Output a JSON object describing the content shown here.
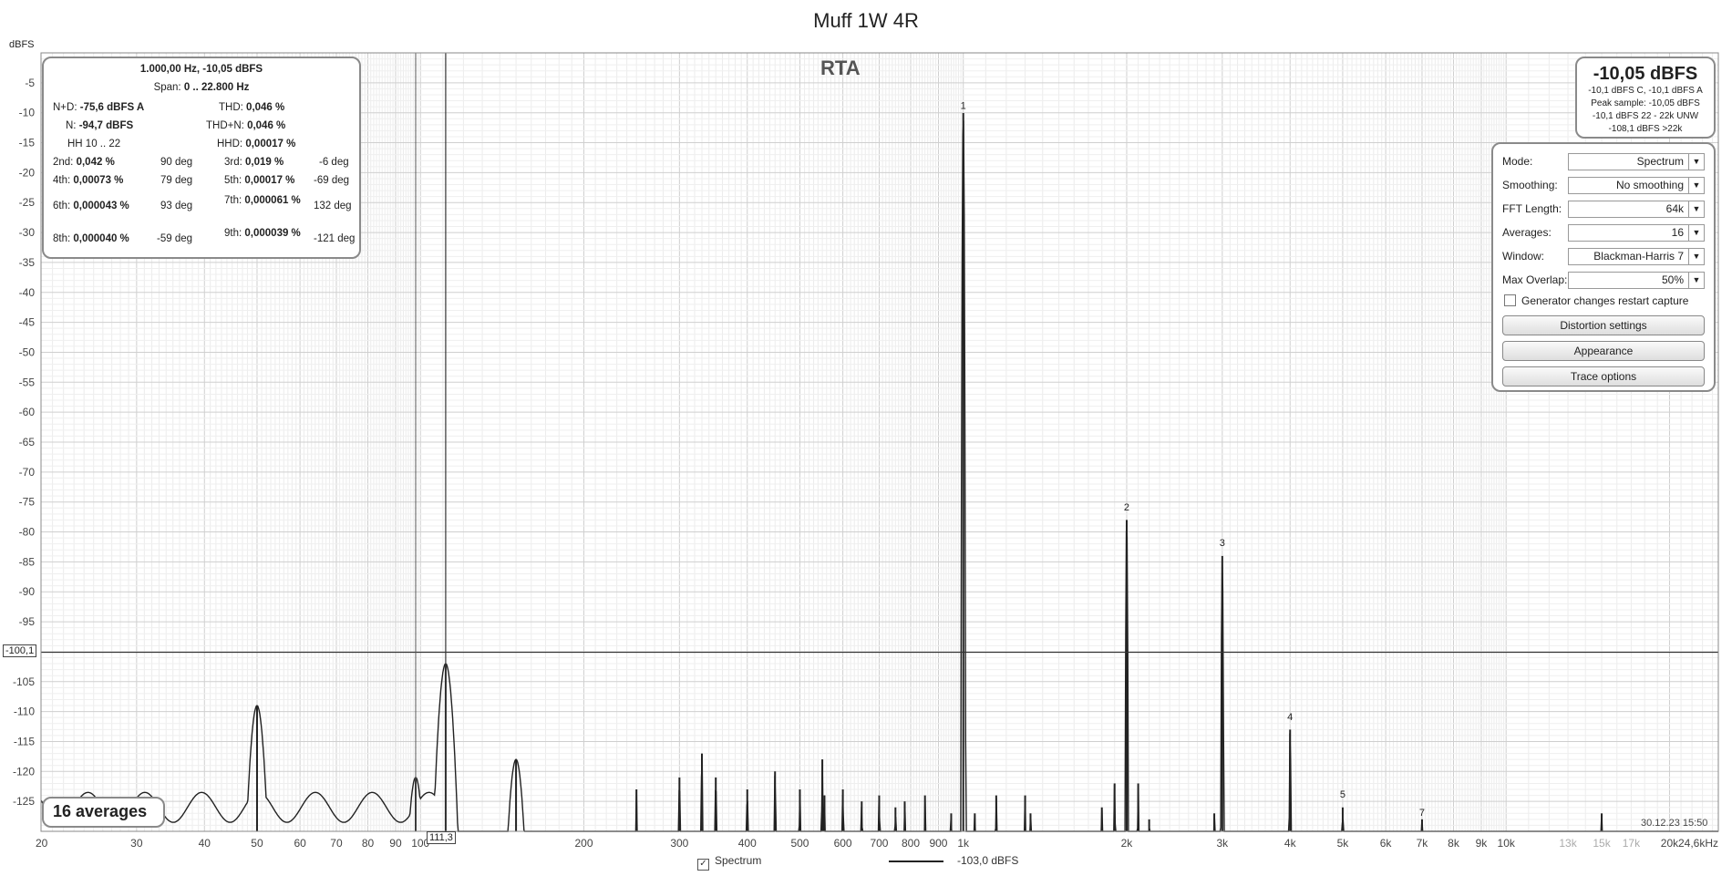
{
  "title": "Muff 1W 4R",
  "y_unit": "dBFS",
  "rta_label": "RTA",
  "stats": {
    "header": "1.000,00 Hz, -10,05 dBFS",
    "span_label": "Span:",
    "span_value": "0 .. 22.800 Hz",
    "nd_label": "N+D:",
    "nd_value": "-75,6 dBFS A",
    "thd_label": "THD:",
    "thd_value": "0,046 %",
    "n_label": "N:",
    "n_value": "-94,7 dBFS",
    "thdn_label": "THD+N:",
    "thdn_value": "0,046 %",
    "hh_label": "HH 10 .. 22",
    "hhd_label": "HHD:",
    "hhd_value": "0,00017 %",
    "h2_label": "2nd:",
    "h2_value": "0,042 %",
    "h2_deg": "90 deg",
    "h3_label": "3rd:",
    "h3_value": "0,019 %",
    "h3_deg": "-6 deg",
    "h4_label": "4th:",
    "h4_value": "0,00073 %",
    "h4_deg": "79 deg",
    "h5_label": "5th:",
    "h5_value": "0,00017 %",
    "h5_deg": "-69 deg",
    "h6_label": "6th:",
    "h6_value": "0,000043 %",
    "h6_deg": "93 deg",
    "h7_label": "7th:",
    "h7_value": "0,000061 %",
    "h7_deg": "132 deg",
    "h8_label": "8th:",
    "h8_value": "0,000040 %",
    "h8_deg": "-59 deg",
    "h9_label": "9th:",
    "h9_value": "0,000039 %",
    "h9_deg": "-121 deg"
  },
  "level": {
    "peak": "-10,05 dBFS",
    "line1": "-10,1 dBFS C, -10,1 dBFS A",
    "line2": "Peak sample: -10,05 dBFS",
    "line3": "-10,1 dBFS 22 - 22k UNW",
    "line4": "-108,1 dBFS >22k"
  },
  "controls": {
    "mode_label": "Mode:",
    "mode_value": "Spectrum",
    "smoothing_label": "Smoothing:",
    "smoothing_value": "No  smoothing",
    "fft_label": "FFT Length:",
    "fft_value": "64k",
    "averages_label": "Averages:",
    "averages_value": "16",
    "window_label": "Window:",
    "window_value": "Blackman-Harris 7",
    "overlap_label": "Max Overlap:",
    "overlap_value": "50%",
    "generator_label": "Generator changes restart capture",
    "distortion_button": "Distortion settings",
    "appearance_button": "Appearance",
    "trace_button": "Trace options"
  },
  "averages_badge": "16 averages",
  "timestamp": "30.12.23 15:50",
  "cursor": {
    "y_readout": "-100,1",
    "x_readout": "111,3"
  },
  "legend": {
    "series_label": "Spectrum",
    "series_check": "✓",
    "readout": "-103,0 dBFS"
  },
  "chart_data": {
    "type": "line",
    "title": "Muff 1W 4R",
    "xlabel": "",
    "ylabel": "dBFS",
    "x_scale": "log",
    "xlim": [
      20,
      24600
    ],
    "ylim": [
      -130,
      0
    ],
    "grid": true,
    "y_ticks": [
      -5,
      -10,
      -15,
      -20,
      -25,
      -30,
      -35,
      -40,
      -45,
      -50,
      -55,
      -60,
      -65,
      -70,
      -75,
      -80,
      -85,
      -90,
      -95,
      -100,
      -105,
      -110,
      -115,
      -120,
      -125
    ],
    "x_ticks": [
      {
        "v": 20,
        "label": "20"
      },
      {
        "v": 30,
        "label": "30"
      },
      {
        "v": 40,
        "label": "40"
      },
      {
        "v": 50,
        "label": "50"
      },
      {
        "v": 60,
        "label": "60"
      },
      {
        "v": 70,
        "label": "70"
      },
      {
        "v": 80,
        "label": "80"
      },
      {
        "v": 90,
        "label": "90"
      },
      {
        "v": 100,
        "label": "100"
      },
      {
        "v": 200,
        "label": "200"
      },
      {
        "v": 300,
        "label": "300"
      },
      {
        "v": 400,
        "label": "400"
      },
      {
        "v": 500,
        "label": "500"
      },
      {
        "v": 600,
        "label": "600"
      },
      {
        "v": 700,
        "label": "700"
      },
      {
        "v": 800,
        "label": "800"
      },
      {
        "v": 900,
        "label": "900"
      },
      {
        "v": 1000,
        "label": "1k"
      },
      {
        "v": 2000,
        "label": "2k"
      },
      {
        "v": 3000,
        "label": "3k"
      },
      {
        "v": 4000,
        "label": "4k"
      },
      {
        "v": 5000,
        "label": "5k"
      },
      {
        "v": 6000,
        "label": "6k"
      },
      {
        "v": 7000,
        "label": "7k"
      },
      {
        "v": 8000,
        "label": "8k"
      },
      {
        "v": 9000,
        "label": "9k"
      },
      {
        "v": 10000,
        "label": "10k"
      },
      {
        "v": 13000,
        "label": "13k",
        "faded": true
      },
      {
        "v": 15000,
        "label": "15k",
        "faded": true
      },
      {
        "v": 17000,
        "label": "17k",
        "faded": true
      },
      {
        "v": 20000,
        "label": "20k"
      },
      {
        "v": 24600,
        "label": "24,6kHz"
      }
    ],
    "series": [
      {
        "peaks": [
          {
            "f": 50,
            "db": -109
          },
          {
            "f": 98,
            "db": -121
          },
          {
            "f": 111.3,
            "db": -102
          },
          {
            "f": 150,
            "db": -118
          },
          {
            "f": 250,
            "db": -123
          },
          {
            "f": 300,
            "db": -121
          },
          {
            "f": 330,
            "db": -117
          },
          {
            "f": 350,
            "db": -121
          },
          {
            "f": 400,
            "db": -123
          },
          {
            "f": 450,
            "db": -120
          },
          {
            "f": 500,
            "db": -123
          },
          {
            "f": 550,
            "db": -118
          },
          {
            "f": 555,
            "db": -124
          },
          {
            "f": 600,
            "db": -123
          },
          {
            "f": 650,
            "db": -125
          },
          {
            "f": 700,
            "db": -124
          },
          {
            "f": 750,
            "db": -126
          },
          {
            "f": 780,
            "db": -125
          },
          {
            "f": 850,
            "db": -124
          },
          {
            "f": 950,
            "db": -127
          },
          {
            "f": 1000,
            "db": -10.05
          },
          {
            "f": 1050,
            "db": -127
          },
          {
            "f": 1150,
            "db": -124
          },
          {
            "f": 1300,
            "db": -124
          },
          {
            "f": 1330,
            "db": -127
          },
          {
            "f": 1800,
            "db": -126
          },
          {
            "f": 1900,
            "db": -122
          },
          {
            "f": 2000,
            "db": -78
          },
          {
            "f": 2100,
            "db": -122
          },
          {
            "f": 2200,
            "db": -128
          },
          {
            "f": 2900,
            "db": -127
          },
          {
            "f": 3000,
            "db": -84
          },
          {
            "f": 4000,
            "db": -113
          },
          {
            "f": 5000,
            "db": -126
          },
          {
            "f": 7000,
            "db": -128
          },
          {
            "f": 15000,
            "db": -127
          }
        ]
      }
    ],
    "harmonic_labels": [
      {
        "n": "1",
        "f": 1000,
        "db": -10
      },
      {
        "n": "2",
        "f": 2000,
        "db": -77
      },
      {
        "n": "3",
        "f": 3000,
        "db": -83
      },
      {
        "n": "4",
        "f": 4000,
        "db": -112
      },
      {
        "n": "5",
        "f": 5000,
        "db": -125
      },
      {
        "n": "7",
        "f": 7000,
        "db": -128
      }
    ],
    "cursor": {
      "f": 111.3,
      "db": -100.1
    }
  }
}
